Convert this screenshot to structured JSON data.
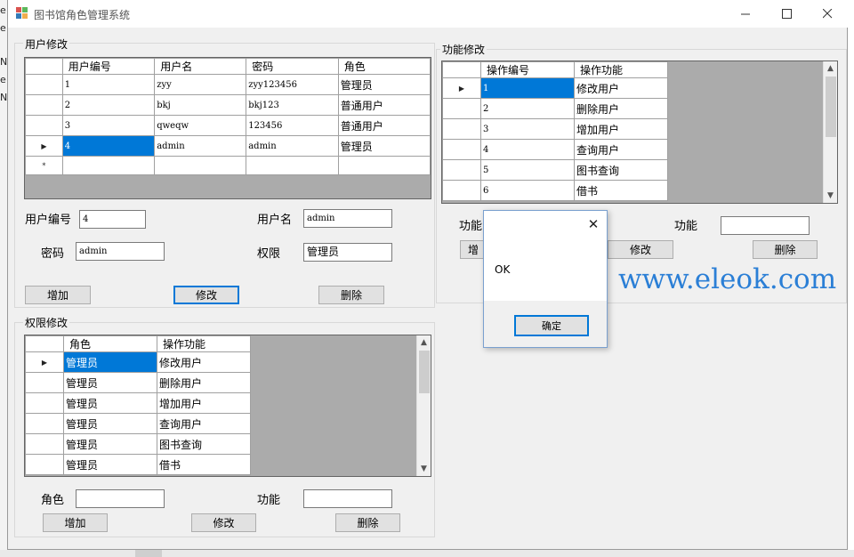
{
  "window": {
    "title": "图书馆角色管理系统"
  },
  "background": {
    "fragments": [
      "e",
      "e",
      "Na",
      "e",
      "Na"
    ]
  },
  "user_group": {
    "label": "用户修改",
    "grid": {
      "headers": [
        "用户编号",
        "用户名",
        "密码",
        "角色"
      ],
      "rows": [
        [
          "1",
          "zyy",
          "zyy123456",
          "管理员"
        ],
        [
          "2",
          "bkj",
          "bkj123",
          "普通用户"
        ],
        [
          "3",
          "qweqw",
          "123456",
          "普通用户"
        ],
        [
          "4",
          "admin",
          "admin",
          "管理员"
        ]
      ],
      "current_marker": "▶",
      "new_row_marker": "*"
    },
    "fields": {
      "user_id_label": "用户编号",
      "user_id_value": "4",
      "username_label": "用户名",
      "username_value": "admin",
      "password_label": "密码",
      "password_value": "admin",
      "permission_label": "权限",
      "permission_value": "管理员"
    },
    "buttons": {
      "add": "增加",
      "modify": "修改",
      "delete": "删除"
    }
  },
  "permission_group": {
    "label": "权限修改",
    "grid": {
      "headers": [
        "角色",
        "操作功能"
      ],
      "rows": [
        [
          "管理员",
          "修改用户"
        ],
        [
          "管理员",
          "删除用户"
        ],
        [
          "管理员",
          "增加用户"
        ],
        [
          "管理员",
          "查询用户"
        ],
        [
          "管理员",
          "图书查询"
        ],
        [
          "管理员",
          "借书"
        ]
      ],
      "current_marker": "▶"
    },
    "fields": {
      "role_label": "角色",
      "role_value": "",
      "function_label": "功能",
      "function_value": ""
    },
    "buttons": {
      "add": "增加",
      "modify": "修改",
      "delete": "删除"
    }
  },
  "function_group": {
    "label": "功能修改",
    "grid": {
      "headers": [
        "操作编号",
        "操作功能"
      ],
      "rows": [
        [
          "1",
          "修改用户"
        ],
        [
          "2",
          "删除用户"
        ],
        [
          "3",
          "增加用户"
        ],
        [
          "4",
          "查询用户"
        ],
        [
          "5",
          "图书查询"
        ],
        [
          "6",
          "借书"
        ]
      ],
      "current_marker": "▶"
    },
    "fields": {
      "function_id_label": "功能",
      "function_label": "功能",
      "function_value": ""
    },
    "buttons": {
      "add_partial": "增",
      "modify": "修改",
      "delete": "删除"
    }
  },
  "dialog": {
    "message": "OK",
    "ok_button": "确定",
    "close_glyph": "✕"
  },
  "watermark": "www.eleok.com",
  "colors": {
    "selection": "#0078d7",
    "watermark": "#2b7fd6",
    "grid_background": "#ababab"
  },
  "icons": {
    "minimize": "minimize-icon",
    "maximize": "maximize-icon",
    "close": "close-icon"
  }
}
